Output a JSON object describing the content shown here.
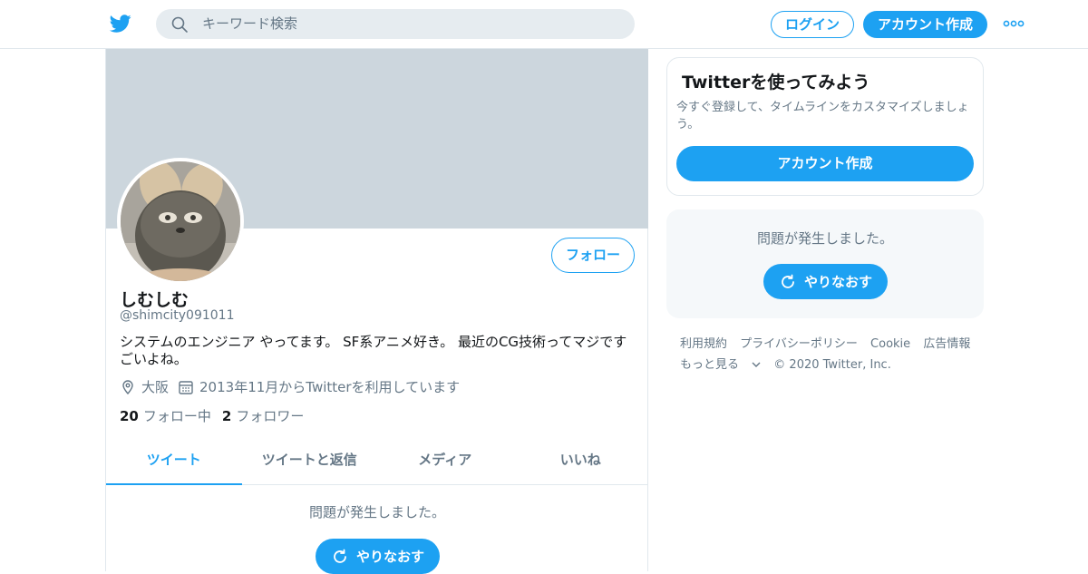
{
  "header": {
    "search_placeholder": "キーワード検索",
    "login_label": "ログイン",
    "signup_label": "アカウント作成"
  },
  "profile": {
    "display_name": "しむしむ",
    "handle": "@shimcity091011",
    "bio": "システムのエンジニア やってます。 SF系アニメ好き。 最近のCG技術ってマジですごいよね。",
    "location": "大阪",
    "joined": "2013年11月からTwitterを利用しています",
    "following_count": "20",
    "following_label": "フォロー中",
    "followers_count": "2",
    "followers_label": "フォロワー",
    "follow_button": "フォロー"
  },
  "tabs": [
    {
      "label": "ツイート",
      "active": true
    },
    {
      "label": "ツイートと返信",
      "active": false
    },
    {
      "label": "メディア",
      "active": false
    },
    {
      "label": "いいね",
      "active": false
    }
  ],
  "timeline": {
    "error_text": "問題が発生しました。",
    "retry_label": "やりなおす"
  },
  "sidebar": {
    "promo_title": "Twitterを使ってみよう",
    "promo_desc": "今すぐ登録して、タイムラインをカスタマイズしましょう。",
    "promo_button": "アカウント作成",
    "error_text": "問題が発生しました。",
    "retry_label": "やりなおす"
  },
  "footer": {
    "links": [
      "利用規約",
      "プライバシーポリシー",
      "Cookie",
      "広告情報"
    ],
    "more": "もっと見る",
    "copyright": "© 2020 Twitter, Inc."
  },
  "colors": {
    "accent": "#1da1f2",
    "banner": "#ccd6dd",
    "secondary_text": "#657786"
  }
}
